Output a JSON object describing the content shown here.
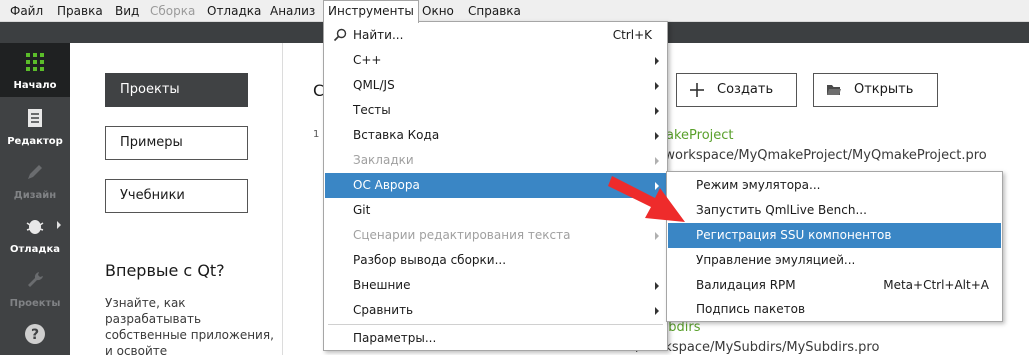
{
  "menubar": {
    "items": [
      {
        "label": "Файл"
      },
      {
        "label": "Правка"
      },
      {
        "label": "Вид"
      },
      {
        "label": "Сборка"
      },
      {
        "label": "Отладка"
      },
      {
        "label": "Анализ"
      },
      {
        "label": "Инструменты"
      },
      {
        "label": "Окно"
      },
      {
        "label": "Справка"
      }
    ]
  },
  "modebar": {
    "items": [
      {
        "label": "Начало",
        "icon": "grid-icon"
      },
      {
        "label": "Редактор",
        "icon": "document-icon"
      },
      {
        "label": "Дизайн",
        "icon": "pen-icon"
      },
      {
        "label": "Отладка",
        "icon": "bug-icon"
      },
      {
        "label": "Проекты",
        "icon": "wrench-icon"
      },
      {
        "label": "",
        "icon": "help-icon"
      }
    ]
  },
  "welcome": {
    "nav": {
      "projects": "Проекты",
      "examples": "Примеры",
      "tutorials": "Учебники"
    },
    "first_time": {
      "title": "Впервые с Qt?",
      "text": "Узнайте, как разрабатывать собственные приложения, и освойте"
    },
    "sessions_title": "С",
    "recent_number": "1",
    "create_label": "Создать",
    "open_label": "Открыть",
    "recent_projects": [
      {
        "name": "akeProject",
        "path": "/workspace/MyQmakeProject/MyQmakeProject.pro"
      },
      {
        "name": "ubdirs",
        "path": "/workspace/MySubdirs/MySubdirs.pro"
      }
    ]
  },
  "tools_menu": {
    "items": [
      {
        "label": "Найти...",
        "shortcut": "Ctrl+K"
      },
      {
        "label": "C++"
      },
      {
        "label": "QML/JS"
      },
      {
        "label": "Тесты"
      },
      {
        "label": "Вставка Кода"
      },
      {
        "label": "Закладки"
      },
      {
        "label": "ОС Аврора"
      },
      {
        "label": "Git"
      },
      {
        "label": "Сценарии редактирования текста"
      },
      {
        "label": "Разбор вывода сборки..."
      },
      {
        "label": "Внешние"
      },
      {
        "label": "Сравнить"
      },
      {
        "label": "Параметры..."
      }
    ]
  },
  "aurora_submenu": {
    "items": [
      {
        "label": "Режим эмулятора..."
      },
      {
        "label": "Запустить QmlLive Bench..."
      },
      {
        "label": "Регистрация SSU компонентов"
      },
      {
        "label": "Управление эмуляцией..."
      },
      {
        "label": "Валидация RPM",
        "shortcut": "Meta+Ctrl+Alt+A"
      },
      {
        "label": "Подпись пакетов"
      }
    ]
  },
  "colors": {
    "highlight": "#3a86c5",
    "modebar": "#404244",
    "project_link": "#5aa02c",
    "annotation_arrow": "#ee2b2b"
  }
}
